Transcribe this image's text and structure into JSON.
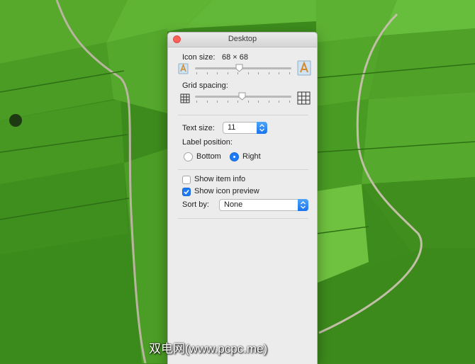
{
  "window": {
    "title": "Desktop"
  },
  "icon_size": {
    "label": "Icon size:",
    "value": "68 × 68",
    "slider_fraction": 0.44
  },
  "grid_spacing": {
    "label": "Grid spacing:",
    "slider_fraction": 0.47
  },
  "text_size": {
    "label": "Text size:",
    "value": "11"
  },
  "label_position": {
    "label": "Label position:",
    "options": [
      "Bottom",
      "Right"
    ],
    "selected": "Right"
  },
  "show_item_info": {
    "label": "Show item info",
    "checked": false
  },
  "show_icon_preview": {
    "label": "Show icon preview",
    "checked": true
  },
  "sort_by": {
    "label": "Sort by:",
    "value": "None"
  },
  "watermark": "双电网(www.pcpc.me)",
  "colors": {
    "accent": "#1f7bf5",
    "close": "#fc605b",
    "panel": "#ececec"
  }
}
